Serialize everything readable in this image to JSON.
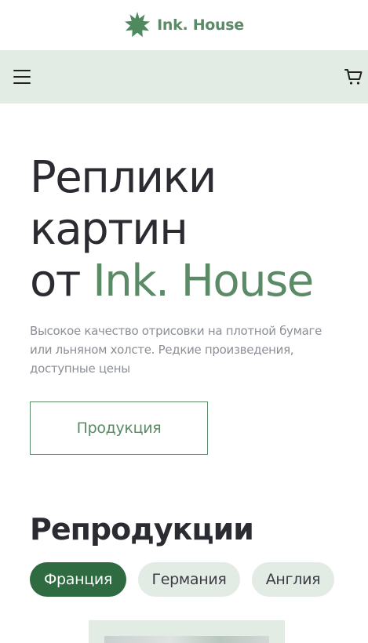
{
  "brand": {
    "name": "Ink. House",
    "accent_color": "#5a8a66",
    "logo_icon": "starburst-icon"
  },
  "nav": {
    "menu_icon": "hamburger-menu-icon",
    "cart_icon": "cart-icon",
    "background": "#e3ebe5"
  },
  "hero": {
    "title_line1": "Реплики",
    "title_line2": "картин",
    "title_prefix": "от ",
    "title_accent": "Ink. House",
    "description": "Высокое качество отрисовки на плотной бумаге или льняном холсте. Редкие произведения, доступные цены",
    "button_label": "Продукция"
  },
  "reproductions": {
    "title": "Репродукции",
    "filters": [
      {
        "label": "Франция",
        "active": true
      },
      {
        "label": "Германия",
        "active": false
      },
      {
        "label": "Англия",
        "active": false
      }
    ],
    "active_color": "#2f6b40"
  }
}
